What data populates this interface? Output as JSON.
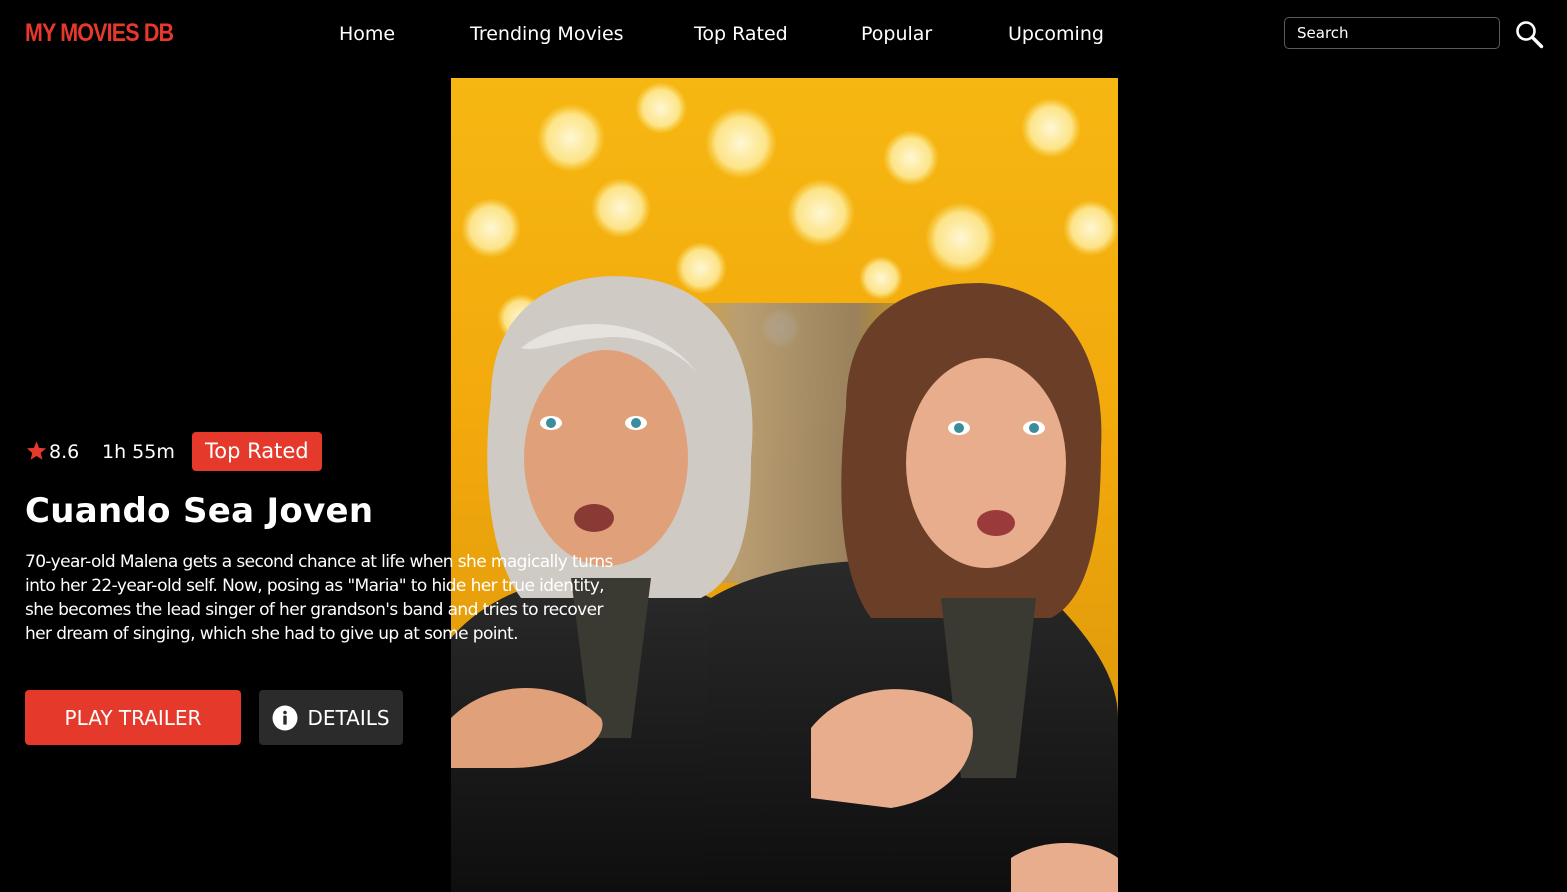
{
  "header": {
    "logo": "MY MOVIES DB",
    "nav": [
      {
        "label": "Home"
      },
      {
        "label": "Trending Movies"
      },
      {
        "label": "Top Rated"
      },
      {
        "label": "Popular"
      },
      {
        "label": "Upcoming"
      }
    ],
    "search": {
      "placeholder": "Search",
      "value": "",
      "icon": "search-icon"
    }
  },
  "hero": {
    "rating": "8.6",
    "rating_icon": "star-icon",
    "runtime": "1h 55m",
    "badge": "Top Rated",
    "title": "Cuando Sea Joven",
    "overview": "70-year-old Malena gets a second chance at life when she magically turns into her 22-year-old self. Now, posing as \"Maria\" to hide her true identity, she becomes the lead singer of her grandson's band and tries to recover her dream of singing, which she had to give up at some point.",
    "play_label": "PLAY TRAILER",
    "details_label": "DETAILS",
    "details_icon": "info-icon"
  },
  "colors": {
    "accent": "#e5392b",
    "logo": "#e8382b",
    "background": "#000000",
    "details_button": "#2b2b2b"
  }
}
